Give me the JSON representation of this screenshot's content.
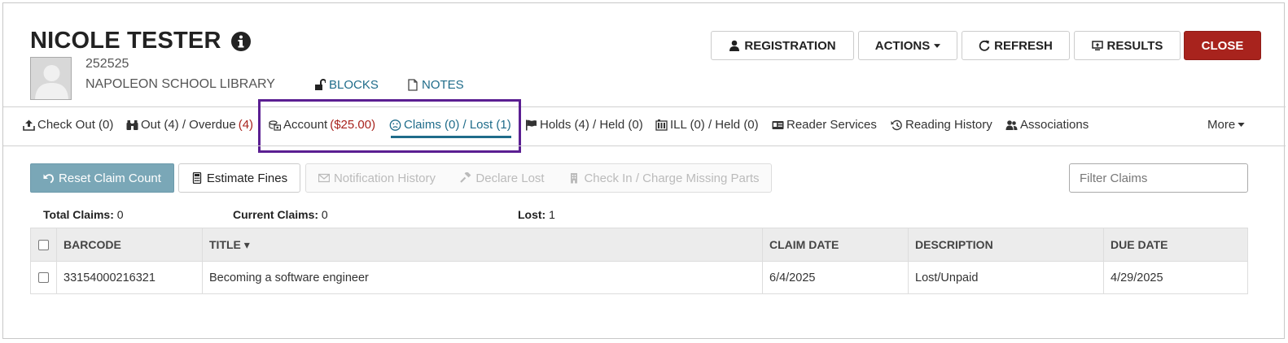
{
  "patron": {
    "name": "NICOLE TESTER",
    "barcode": "252525",
    "library": "NAPOLEON SCHOOL LIBRARY",
    "blocks_label": "BLOCKS",
    "notes_label": "NOTES"
  },
  "header_buttons": {
    "registration": "REGISTRATION",
    "actions": "ACTIONS",
    "refresh": "REFRESH",
    "results": "RESULTS",
    "close": "CLOSE"
  },
  "tabs": {
    "checkout": "Check Out (0)",
    "out_prefix": "Out (4) / Overdue ",
    "out_overdue": "(4)",
    "account_prefix": "Account ",
    "account_amount": "($25.00)",
    "claims": "Claims (0) / Lost (1)",
    "holds": "Holds (4) / Held (0)",
    "ill": "ILL (0) / Held (0)",
    "reader_services": "Reader Services",
    "reading_history": "Reading History",
    "associations": "Associations",
    "more": "More"
  },
  "toolbar": {
    "reset": "Reset Claim Count",
    "estimate": "Estimate Fines",
    "notification": "Notification History",
    "declare_lost": "Declare Lost",
    "checkin": "Check In / Charge Missing Parts",
    "filter_placeholder": "Filter Claims"
  },
  "stats": {
    "total_label": "Total Claims:",
    "total_value": "0",
    "current_label": "Current Claims:",
    "current_value": "0",
    "lost_label": "Lost:",
    "lost_value": "1"
  },
  "table": {
    "headers": {
      "barcode": "BARCODE",
      "title": "TITLE ▾",
      "claim_date": "CLAIM DATE",
      "description": "DESCRIPTION",
      "due_date": "DUE DATE"
    },
    "rows": [
      {
        "barcode": "33154000216321",
        "title": "Becoming a software engineer",
        "claim_date": "6/4/2025",
        "description": "Lost/Unpaid",
        "due_date": "4/29/2025"
      }
    ]
  },
  "colors": {
    "accent": "#1f6c8a",
    "close": "#a8231d",
    "highlight": "#5b1f92",
    "reset": "#7aa7b7"
  }
}
